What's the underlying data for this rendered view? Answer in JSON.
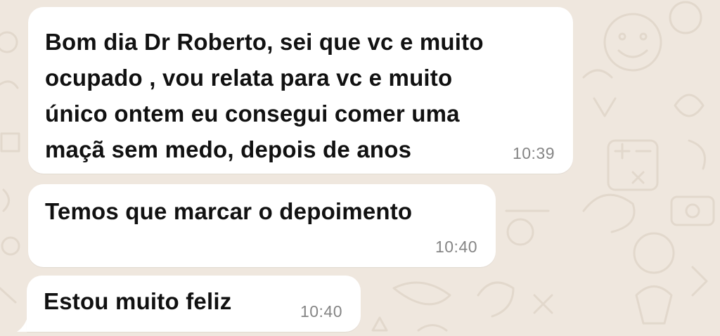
{
  "chat": {
    "background_color": "#efe7de",
    "bubble_color": "#ffffff",
    "messages": [
      {
        "text": "Bom dia Dr Roberto, sei que vc e muito\nocupado , vou relata para vc e muito\núnico ontem eu consegui comer uma\nmaçã sem medo, depois de anos",
        "time": "10:39"
      },
      {
        "text": "Temos que marcar o depoimento",
        "time": "10:40"
      },
      {
        "text": "Estou muito feliz",
        "time": "10:40"
      }
    ]
  }
}
